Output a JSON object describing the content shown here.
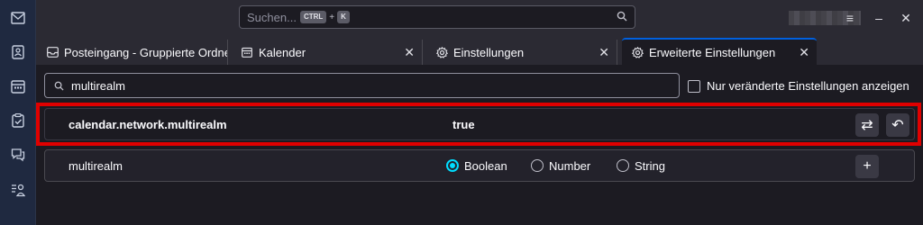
{
  "spaces_toolbar": {
    "items": [
      "mail-icon",
      "address-book-icon",
      "calendar-icon",
      "tasks-icon",
      "chat-icon",
      "settings-list-icon"
    ]
  },
  "titlebar": {
    "search_placeholder": "Suchen...",
    "shortcut_key1": "CTRL",
    "shortcut_plus": "+",
    "shortcut_key2": "K",
    "menu_glyph": "≡",
    "minimize_glyph": "–",
    "close_glyph": "✕"
  },
  "tabs": [
    {
      "label": "Posteingang - Gruppierte Ordner",
      "icon": "inbox-icon"
    },
    {
      "label": "Kalender",
      "icon": "calendar-icon"
    },
    {
      "label": "Einstellungen",
      "icon": "gear-icon"
    },
    {
      "label": "Erweiterte Einstellungen",
      "icon": "gear-icon"
    }
  ],
  "tab_close_glyph": "✕",
  "filter": {
    "value": "multirealm",
    "checkbox_label": "Nur veränderte Einstellungen anzeigen"
  },
  "pref_row": {
    "name": "calendar.network.multirealm",
    "value": "true",
    "toggle_glyph": "⇄",
    "reset_glyph": "↶"
  },
  "new_pref_row": {
    "name": "multirealm",
    "types": [
      "Boolean",
      "Number",
      "String"
    ],
    "selected_type": "Boolean",
    "add_glyph": "+"
  },
  "colors": {
    "accent": "#00ddff",
    "highlight_border": "#e00000",
    "active_tab_indicator": "#0060df"
  }
}
